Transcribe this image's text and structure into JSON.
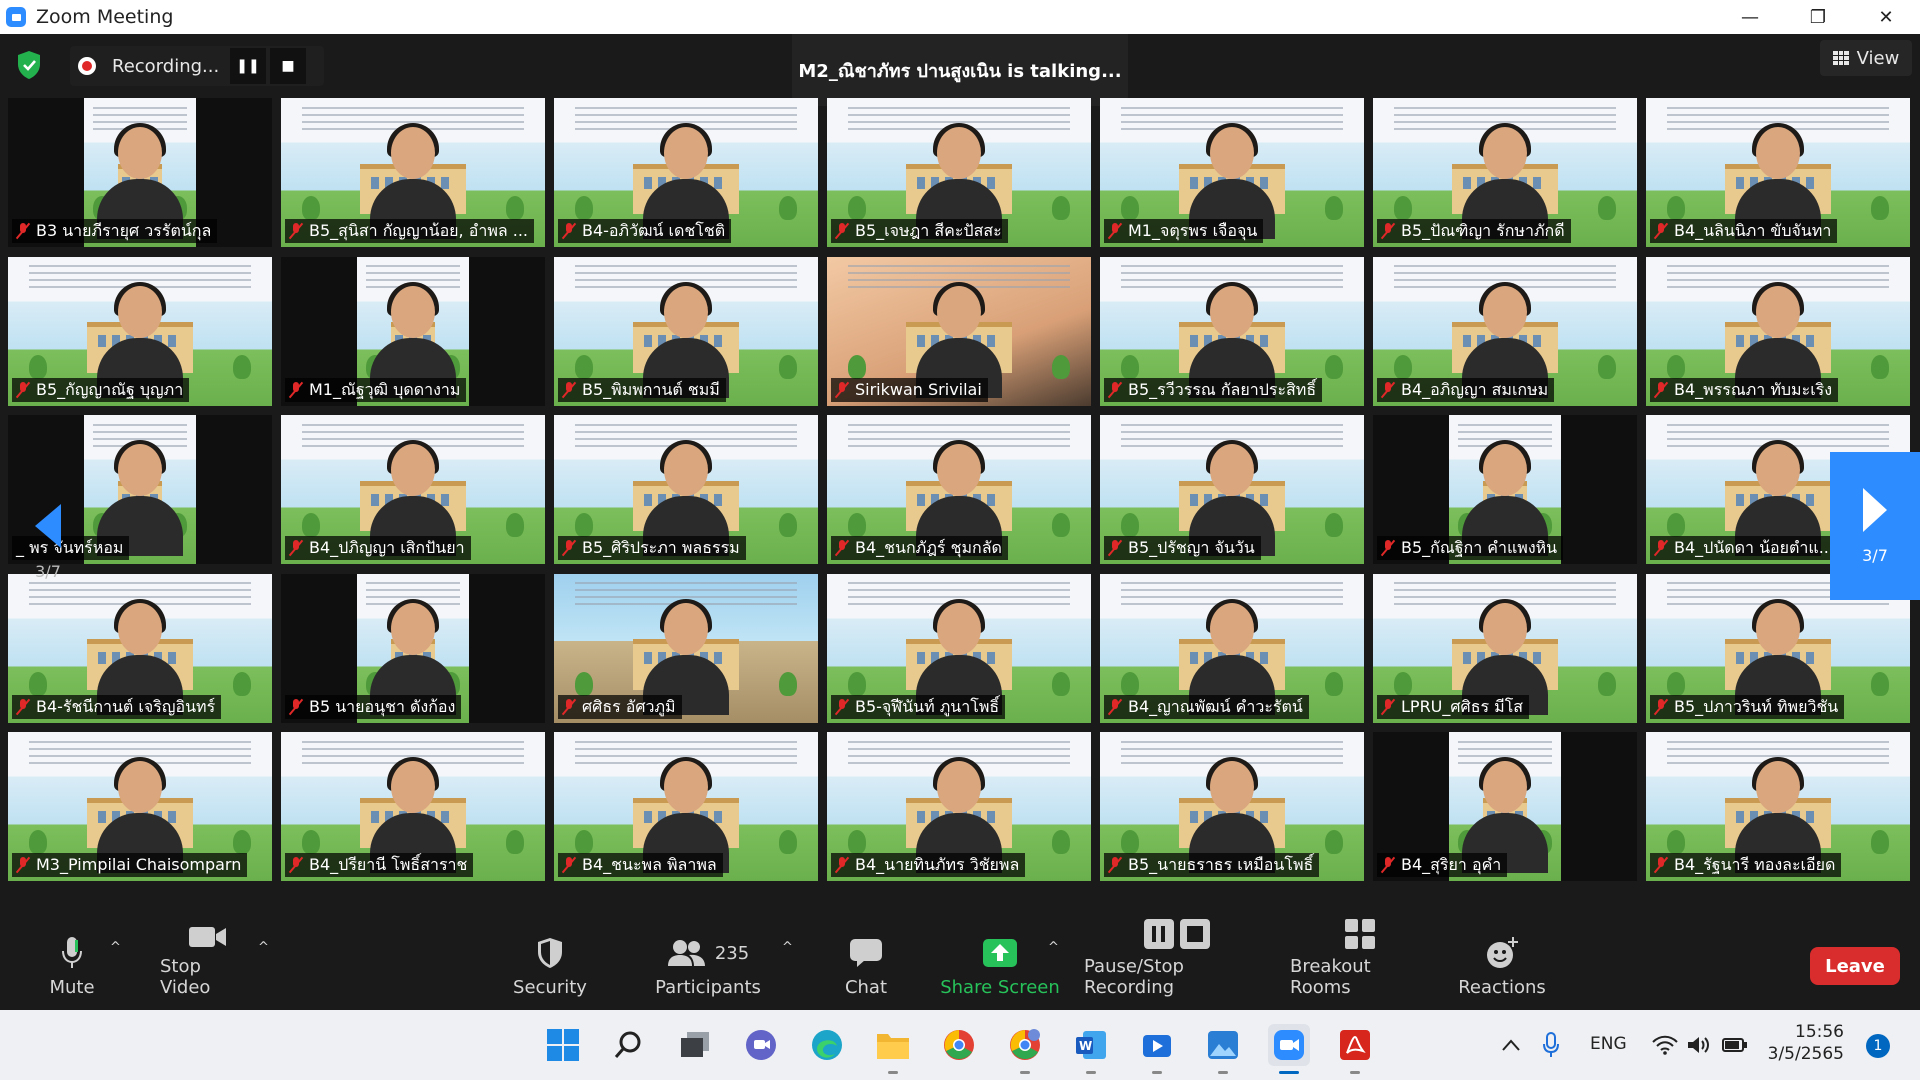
{
  "window": {
    "title": "Zoom Meeting",
    "minimize": "—",
    "maximize": "❐",
    "close": "✕"
  },
  "meeting": {
    "recording_label": "Recording...",
    "talking": "M2_ณิชาภัทร ปานสูงเนิน is talking...",
    "view_label": "View",
    "page_indicator": "3/7"
  },
  "participants": [
    {
      "name": "B3 นายภีรายุศ วรรัตน์กุล",
      "muted": true
    },
    {
      "name": "B5_สุนิสา กัญญาน้อย, อำพล ...",
      "muted": true
    },
    {
      "name": "B4-อภิวัฒน์ เดชโชติ",
      "muted": true
    },
    {
      "name": "B5_เจษฎา สีคะปัสสะ",
      "muted": true
    },
    {
      "name": "M1_จตุรพร เจือจุน",
      "muted": true
    },
    {
      "name": "B5_ปัณฑิญา รักษาภักดี",
      "muted": true
    },
    {
      "name": "B4_นลินนิภา ขับจันทา",
      "muted": true
    },
    {
      "name": "B5_กัญญาณัฐ บุญภา",
      "muted": true
    },
    {
      "name": "M1_ณัฐวุฒิ บุดดางาม",
      "muted": true
    },
    {
      "name": "B5_พิมพกานต์ ชมมี",
      "muted": true
    },
    {
      "name": "Sirikwan Srivilai",
      "muted": true
    },
    {
      "name": "B5_รวีวรรณ กัลยาประสิทธิ์",
      "muted": true
    },
    {
      "name": "B4_อภิญญา สมเกษม",
      "muted": true
    },
    {
      "name": "B4_พรรณภา ทับมะเริง",
      "muted": true
    },
    {
      "name": "_ พร จันทร์หอม",
      "muted": false
    },
    {
      "name": "B4_ปภิญญา เสิกปันยา",
      "muted": true
    },
    {
      "name": "B5_ศิริประภา พลธรรม",
      "muted": true
    },
    {
      "name": "B4_ชนกภัฎร์ ชุมกลัด",
      "muted": true
    },
    {
      "name": "B5_ปรัชญา จันวัน",
      "muted": true
    },
    {
      "name": "B5_กัณฐิกา คำแพงหิน",
      "muted": true
    },
    {
      "name": "B4_ปนัดดา น้อยตำแ...",
      "muted": true
    },
    {
      "name": "B4-รัชนีกานต์ เจริญอินทร์",
      "muted": true
    },
    {
      "name": "B5 นายอนุชา ดังก้อง",
      "muted": true
    },
    {
      "name": "ศศิธร อัศวภูมิ",
      "muted": true
    },
    {
      "name": "B5-จุฬีนันท์ ภูนาโพธิ์",
      "muted": true
    },
    {
      "name": "B4_ญาณพัฒน์ คำวะรัตน์",
      "muted": true
    },
    {
      "name": "LPRU_ศศิธร มีโส",
      "muted": true
    },
    {
      "name": "B5_ปภาวรินท์ ทิพยวิชัน",
      "muted": true
    },
    {
      "name": "M3_Pimpilai Chaisomparn",
      "muted": true
    },
    {
      "name": "B4_ปรียานี โพธิ์สาราช",
      "muted": true
    },
    {
      "name": "B4_ชนะพล พิลาพล",
      "muted": true
    },
    {
      "name": "B4_นายทินภัทร วิชัยพล",
      "muted": true
    },
    {
      "name": "B5_นายธราธร เหมือนโพธิ์",
      "muted": true
    },
    {
      "name": "B4_สุริยา อุคำ",
      "muted": true
    },
    {
      "name": "B4_รัฐนารี ทองละเอียด",
      "muted": true
    }
  ],
  "toolbar": {
    "mute": "Mute",
    "stop_video": "Stop Video",
    "security": "Security",
    "participants": "Participants",
    "participant_count": "235",
    "chat": "Chat",
    "share_screen": "Share Screen",
    "pause_stop_recording": "Pause/Stop Recording",
    "breakout_rooms": "Breakout Rooms",
    "reactions": "Reactions",
    "leave": "Leave"
  },
  "taskbar": {
    "language": "ENG",
    "time": "15:56",
    "date": "3/5/2565",
    "notification_count": "1",
    "apps": [
      "start-icon",
      "search-icon",
      "task-view-icon",
      "teams-chat-icon",
      "edge-icon",
      "file-explorer-icon",
      "chrome-icon",
      "chrome-profile-icon",
      "word-icon",
      "media-player-icon",
      "photos-icon",
      "zoom-icon",
      "acrobat-icon"
    ]
  },
  "colors": {
    "accent": "#2d8cff",
    "leave": "#d92c2c",
    "share": "#27c25a",
    "muted_mic": "#e02828"
  }
}
